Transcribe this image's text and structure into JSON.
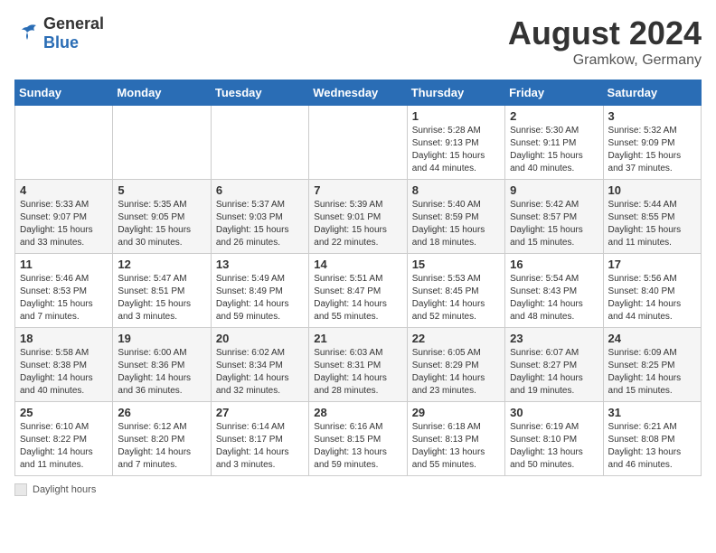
{
  "header": {
    "logo_general": "General",
    "logo_blue": "Blue",
    "month_year": "August 2024",
    "location": "Gramkow, Germany"
  },
  "footer": {
    "daylight_label": "Daylight hours"
  },
  "days_of_week": [
    "Sunday",
    "Monday",
    "Tuesday",
    "Wednesday",
    "Thursday",
    "Friday",
    "Saturday"
  ],
  "weeks": [
    [
      {
        "num": "",
        "info": ""
      },
      {
        "num": "",
        "info": ""
      },
      {
        "num": "",
        "info": ""
      },
      {
        "num": "",
        "info": ""
      },
      {
        "num": "1",
        "info": "Sunrise: 5:28 AM\nSunset: 9:13 PM\nDaylight: 15 hours\nand 44 minutes."
      },
      {
        "num": "2",
        "info": "Sunrise: 5:30 AM\nSunset: 9:11 PM\nDaylight: 15 hours\nand 40 minutes."
      },
      {
        "num": "3",
        "info": "Sunrise: 5:32 AM\nSunset: 9:09 PM\nDaylight: 15 hours\nand 37 minutes."
      }
    ],
    [
      {
        "num": "4",
        "info": "Sunrise: 5:33 AM\nSunset: 9:07 PM\nDaylight: 15 hours\nand 33 minutes."
      },
      {
        "num": "5",
        "info": "Sunrise: 5:35 AM\nSunset: 9:05 PM\nDaylight: 15 hours\nand 30 minutes."
      },
      {
        "num": "6",
        "info": "Sunrise: 5:37 AM\nSunset: 9:03 PM\nDaylight: 15 hours\nand 26 minutes."
      },
      {
        "num": "7",
        "info": "Sunrise: 5:39 AM\nSunset: 9:01 PM\nDaylight: 15 hours\nand 22 minutes."
      },
      {
        "num": "8",
        "info": "Sunrise: 5:40 AM\nSunset: 8:59 PM\nDaylight: 15 hours\nand 18 minutes."
      },
      {
        "num": "9",
        "info": "Sunrise: 5:42 AM\nSunset: 8:57 PM\nDaylight: 15 hours\nand 15 minutes."
      },
      {
        "num": "10",
        "info": "Sunrise: 5:44 AM\nSunset: 8:55 PM\nDaylight: 15 hours\nand 11 minutes."
      }
    ],
    [
      {
        "num": "11",
        "info": "Sunrise: 5:46 AM\nSunset: 8:53 PM\nDaylight: 15 hours\nand 7 minutes."
      },
      {
        "num": "12",
        "info": "Sunrise: 5:47 AM\nSunset: 8:51 PM\nDaylight: 15 hours\nand 3 minutes."
      },
      {
        "num": "13",
        "info": "Sunrise: 5:49 AM\nSunset: 8:49 PM\nDaylight: 14 hours\nand 59 minutes."
      },
      {
        "num": "14",
        "info": "Sunrise: 5:51 AM\nSunset: 8:47 PM\nDaylight: 14 hours\nand 55 minutes."
      },
      {
        "num": "15",
        "info": "Sunrise: 5:53 AM\nSunset: 8:45 PM\nDaylight: 14 hours\nand 52 minutes."
      },
      {
        "num": "16",
        "info": "Sunrise: 5:54 AM\nSunset: 8:43 PM\nDaylight: 14 hours\nand 48 minutes."
      },
      {
        "num": "17",
        "info": "Sunrise: 5:56 AM\nSunset: 8:40 PM\nDaylight: 14 hours\nand 44 minutes."
      }
    ],
    [
      {
        "num": "18",
        "info": "Sunrise: 5:58 AM\nSunset: 8:38 PM\nDaylight: 14 hours\nand 40 minutes."
      },
      {
        "num": "19",
        "info": "Sunrise: 6:00 AM\nSunset: 8:36 PM\nDaylight: 14 hours\nand 36 minutes."
      },
      {
        "num": "20",
        "info": "Sunrise: 6:02 AM\nSunset: 8:34 PM\nDaylight: 14 hours\nand 32 minutes."
      },
      {
        "num": "21",
        "info": "Sunrise: 6:03 AM\nSunset: 8:31 PM\nDaylight: 14 hours\nand 28 minutes."
      },
      {
        "num": "22",
        "info": "Sunrise: 6:05 AM\nSunset: 8:29 PM\nDaylight: 14 hours\nand 23 minutes."
      },
      {
        "num": "23",
        "info": "Sunrise: 6:07 AM\nSunset: 8:27 PM\nDaylight: 14 hours\nand 19 minutes."
      },
      {
        "num": "24",
        "info": "Sunrise: 6:09 AM\nSunset: 8:25 PM\nDaylight: 14 hours\nand 15 minutes."
      }
    ],
    [
      {
        "num": "25",
        "info": "Sunrise: 6:10 AM\nSunset: 8:22 PM\nDaylight: 14 hours\nand 11 minutes."
      },
      {
        "num": "26",
        "info": "Sunrise: 6:12 AM\nSunset: 8:20 PM\nDaylight: 14 hours\nand 7 minutes."
      },
      {
        "num": "27",
        "info": "Sunrise: 6:14 AM\nSunset: 8:17 PM\nDaylight: 14 hours\nand 3 minutes."
      },
      {
        "num": "28",
        "info": "Sunrise: 6:16 AM\nSunset: 8:15 PM\nDaylight: 13 hours\nand 59 minutes."
      },
      {
        "num": "29",
        "info": "Sunrise: 6:18 AM\nSunset: 8:13 PM\nDaylight: 13 hours\nand 55 minutes."
      },
      {
        "num": "30",
        "info": "Sunrise: 6:19 AM\nSunset: 8:10 PM\nDaylight: 13 hours\nand 50 minutes."
      },
      {
        "num": "31",
        "info": "Sunrise: 6:21 AM\nSunset: 8:08 PM\nDaylight: 13 hours\nand 46 minutes."
      }
    ]
  ]
}
